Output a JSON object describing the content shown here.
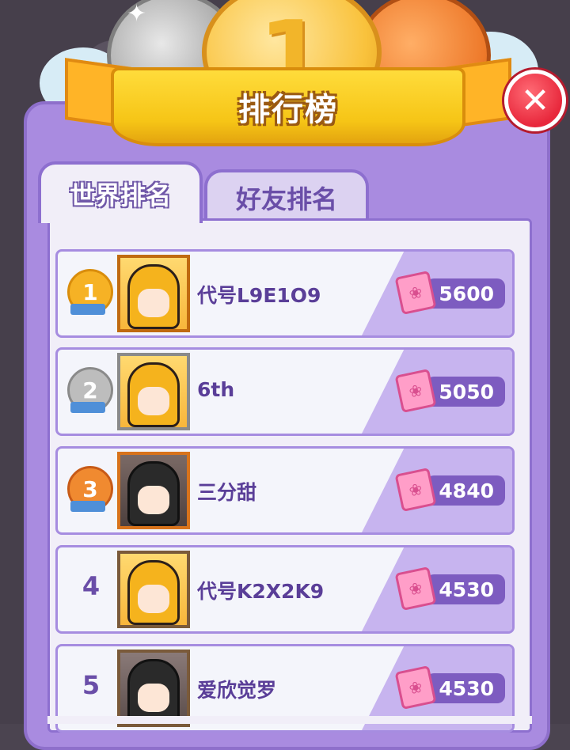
{
  "header": {
    "title": "排行榜",
    "gold_coin_label": "1"
  },
  "tabs": [
    {
      "label": "世界排名",
      "active": true
    },
    {
      "label": "好友排名",
      "active": false
    }
  ],
  "leaderboard": [
    {
      "rank": "1",
      "medal": "gold",
      "name": "代号L9E1O9",
      "score": "5600"
    },
    {
      "rank": "2",
      "medal": "silver",
      "name": "6th",
      "score": "5050"
    },
    {
      "rank": "3",
      "medal": "bronze",
      "name": "三分甜",
      "score": "4840"
    },
    {
      "rank": "4",
      "medal": "none",
      "name": "代号K2X2K9",
      "score": "4530"
    },
    {
      "rank": "5",
      "medal": "none",
      "name": "爱欣觉罗",
      "score": "4530"
    }
  ],
  "icons": {
    "close": "close-icon",
    "score": "ticket-icon"
  },
  "colors": {
    "panel": "#a98be0",
    "ribbon": "#f6c516",
    "close": "#e8283c",
    "score_bg": "#7d5cc0"
  }
}
